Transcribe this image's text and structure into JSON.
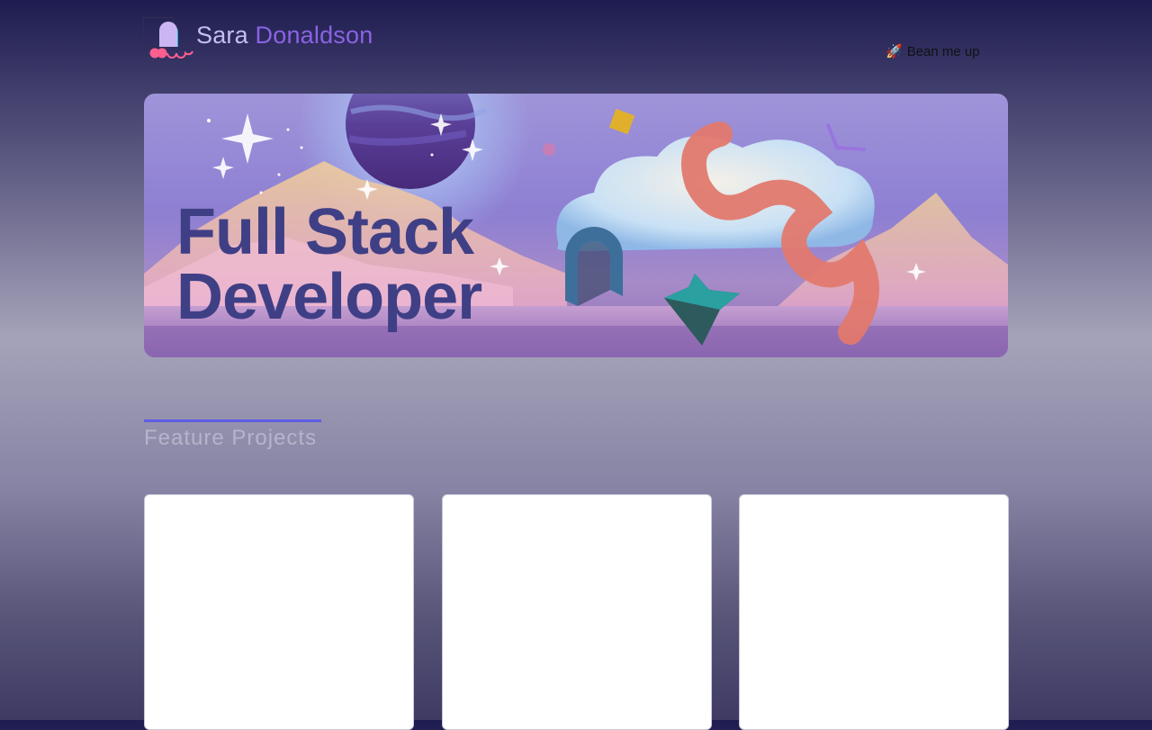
{
  "header": {
    "brand_first": "Sara",
    "brand_last": "Donaldson",
    "logo_icon": "arches-logo-icon",
    "nav_link": "Bean me up",
    "nav_link_icon": "rocket-icon",
    "nav_link_emoji": "🚀"
  },
  "hero": {
    "title_line1": "Full Stack",
    "title_line2": "Developer"
  },
  "section": {
    "heading": "Feature Projects"
  },
  "projects": [
    {},
    {},
    {}
  ],
  "colors": {
    "accent": "#5f5ce4",
    "brand_last": "#8a63e4",
    "hero_title": "#3f3f86"
  }
}
